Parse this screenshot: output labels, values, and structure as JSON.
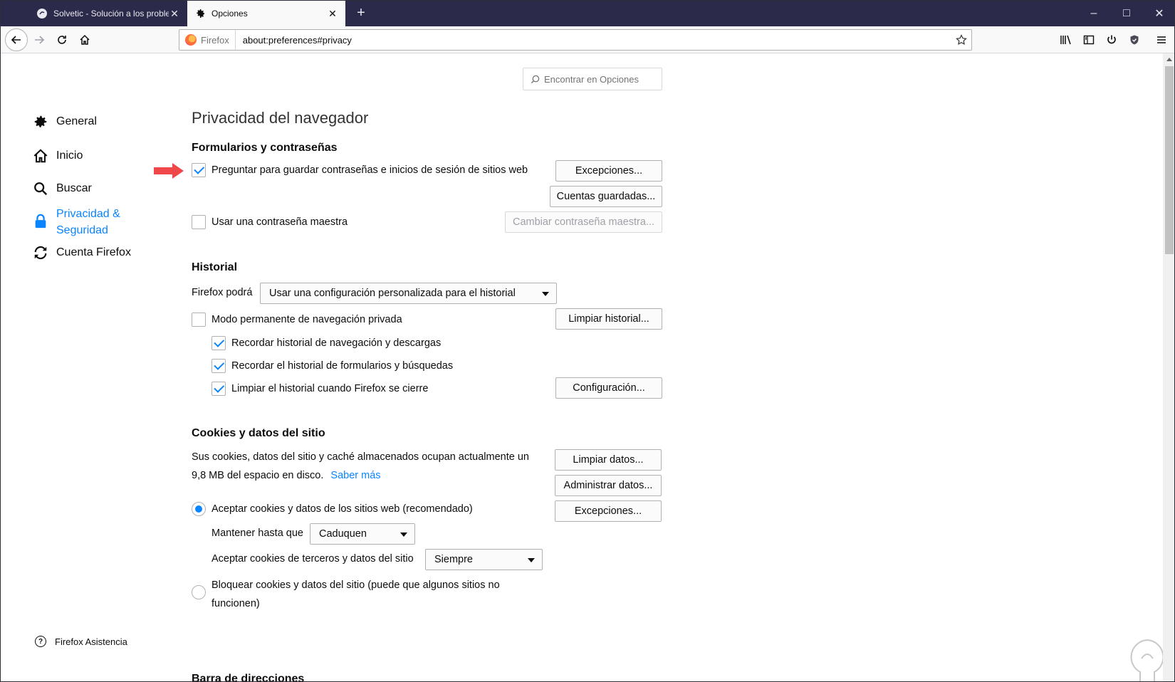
{
  "tabs": [
    {
      "title": "Solvetic - Solución a los proble",
      "active": false,
      "icon": "solvetic-icon"
    },
    {
      "title": "Opciones",
      "active": true,
      "icon": "gear-icon"
    }
  ],
  "window": {
    "minimize": "–",
    "maximize": "□",
    "close": "✕"
  },
  "urlbar": {
    "identity": "Firefox",
    "url": "about:preferences#privacy"
  },
  "search": {
    "placeholder": "Encontrar en Opciones"
  },
  "sidebar": {
    "items": [
      {
        "label": "General",
        "icon": "gear-icon"
      },
      {
        "label": "Inicio",
        "icon": "home-icon"
      },
      {
        "label": "Buscar",
        "icon": "search-icon"
      },
      {
        "label_line1": "Privacidad &",
        "label_line2": "Seguridad",
        "icon": "lock-icon",
        "selected": true
      },
      {
        "label": "Cuenta Firefox",
        "icon": "sync-icon"
      }
    ],
    "help": "Firefox Asistencia"
  },
  "pane": {
    "title": "Privacidad del navegador",
    "forms": {
      "heading": "Formularios y contraseñas",
      "ask_save": "Preguntar para guardar contraseñas e inicios de sesión de sitios web",
      "ask_save_checked": true,
      "exceptions_btn": "Excepciones...",
      "saved_logins_btn": "Cuentas guardadas...",
      "master_pw": "Usar una contraseña maestra",
      "master_pw_checked": false,
      "change_master_btn": "Cambiar contraseña maestra..."
    },
    "history": {
      "heading": "Historial",
      "mode_label": "Firefox podrá",
      "mode_value": "Usar una configuración personalizada para el historial",
      "private_mode": "Modo permanente de navegación privada",
      "clear_history_btn": "Limpiar historial...",
      "remember_browsing": "Recordar historial de navegación y descargas",
      "remember_forms": "Recordar el historial de formularios y búsquedas",
      "clear_on_close": "Limpiar el historial cuando Firefox se cierre",
      "settings_btn": "Configuración..."
    },
    "cookies": {
      "heading": "Cookies y datos del sitio",
      "usage_line1": "Sus cookies, datos del sitio y caché almacenados ocupan actualmente un",
      "usage_line2": "9,8 MB del espacio en disco.",
      "learn_more": "Saber más",
      "clear_data_btn": "Limpiar datos...",
      "manage_data_btn": "Administrar datos...",
      "exceptions_btn": "Excepciones...",
      "accept": "Aceptar cookies y datos de los sitios web (recomendado)",
      "keep_until_label": "Mantener hasta que",
      "keep_until_value": "Caduquen",
      "third_party_label": "Aceptar cookies de terceros y datos del sitio",
      "third_party_value": "Siempre",
      "block_line1": "Bloquear cookies y datos del sitio (puede que algunos sitios no",
      "block_line2": "funcionen)"
    },
    "next_heading": "Barra de direcciones"
  },
  "colors": {
    "accent": "#0a84ff",
    "tabbar": "#2b2a4a",
    "arrow": "#f0484a"
  }
}
